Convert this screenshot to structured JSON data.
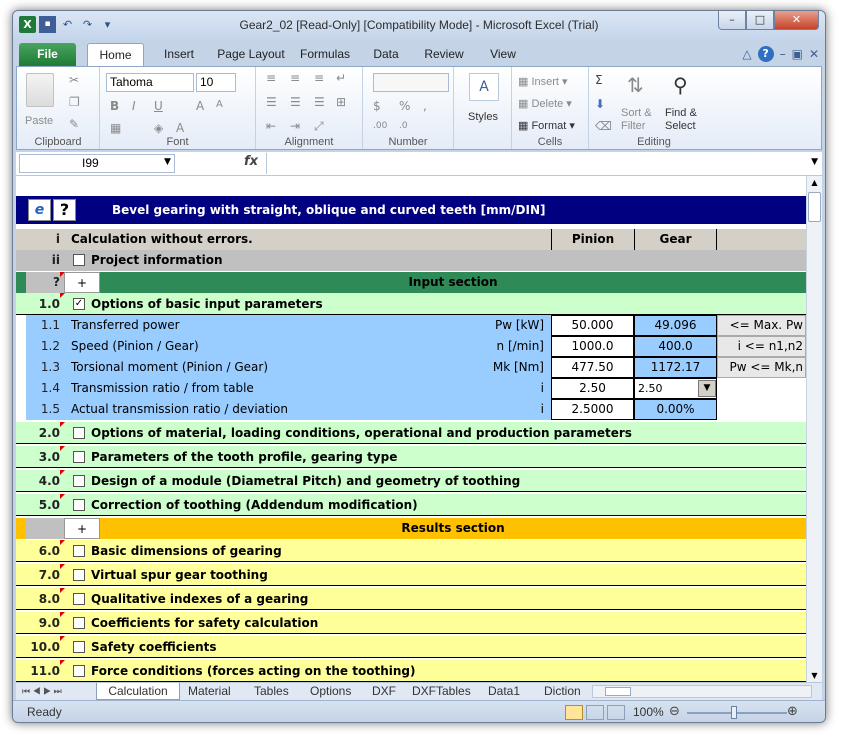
{
  "window": {
    "title": "Gear2_02  [Read-Only]  [Compatibility Mode]  -  Microsoft Excel (Trial)"
  },
  "ribbon": {
    "tabs": [
      "File",
      "Home",
      "Insert",
      "Page Layout",
      "Formulas",
      "Data",
      "Review",
      "View"
    ],
    "clipboard": {
      "label": "Clipboard",
      "paste": "Paste"
    },
    "font": {
      "label": "Font",
      "name": "Tahoma",
      "size": "10"
    },
    "alignment": {
      "label": "Alignment"
    },
    "number": {
      "label": "Number"
    },
    "styles": {
      "label": "Styles"
    },
    "cells": {
      "label": "Cells",
      "insert": "Insert",
      "delete": "Delete",
      "format": "Format"
    },
    "editing": {
      "label": "Editing",
      "sort": "Sort &",
      "filter": "Filter",
      "find": "Find &",
      "select": "Select"
    }
  },
  "formula_bar": {
    "name_box": "I99",
    "fx": "fx",
    "value": ""
  },
  "sheet": {
    "title": "Bevel gearing with straight, oblique and curved teeth [mm/DIN]",
    "header_row": {
      "num": "i",
      "text": "Calculation without errors.",
      "col1": "Pinion",
      "col2": "Gear"
    },
    "project_row": {
      "num": "ii",
      "text": "Project information"
    },
    "input_section": {
      "num": "?",
      "plus": "+",
      "label": "Input section"
    },
    "options_row": {
      "num": "1.0",
      "text": "Options of basic input parameters",
      "check": "✓"
    },
    "param_rows": [
      {
        "num": "1.1",
        "label": "Transferred power",
        "unit": "Pw [kW]",
        "v1": "50.000",
        "v2": "49.096",
        "note": "<= Max. Pw"
      },
      {
        "num": "1.2",
        "label": "Speed (Pinion / Gear)",
        "unit": "n [/min]",
        "v1": "1000.0",
        "v2": "400.0",
        "note": "i <= n1,n2"
      },
      {
        "num": "1.3",
        "label": "Torsional moment (Pinion / Gear)",
        "unit": "Mk [Nm]",
        "v1": "477.50",
        "v2": "1172.17",
        "note": "Pw <= Mk,n"
      },
      {
        "num": "1.4",
        "label": "Transmission ratio / from table",
        "unit": "i",
        "v1": "2.50",
        "v2": "2.50",
        "note": ""
      },
      {
        "num": "1.5",
        "label": "Actual transmission ratio / deviation",
        "unit": "i",
        "v1": "2.5000",
        "v2": "0.00%",
        "note": ""
      }
    ],
    "input_groups": [
      {
        "num": "2.0",
        "text": "Options of material, loading conditions, operational and production parameters"
      },
      {
        "num": "3.0",
        "text": "Parameters of the tooth profile, gearing type"
      },
      {
        "num": "4.0",
        "text": "Design of a module (Diametral Pitch) and geometry of toothing"
      },
      {
        "num": "5.0",
        "text": "Correction of toothing (Addendum modification)"
      }
    ],
    "results_section": {
      "plus": "+",
      "label": "Results section"
    },
    "result_groups": [
      {
        "num": "6.0",
        "text": "Basic dimensions of gearing"
      },
      {
        "num": "7.0",
        "text": "Virtual spur gear toothing"
      },
      {
        "num": "8.0",
        "text": "Qualitative indexes of a gearing"
      },
      {
        "num": "9.0",
        "text": "Coefficients for safety calculation"
      },
      {
        "num": "10.0",
        "text": "Safety coefficients"
      },
      {
        "num": "11.0",
        "text": "Force conditions (forces acting on the toothing)"
      }
    ]
  },
  "sheet_tabs": [
    "Calculation",
    "Material",
    "Tables",
    "Options",
    "DXF",
    "DXFTables",
    "Data1",
    "Diction"
  ],
  "status": {
    "ready": "Ready",
    "zoom": "100%"
  },
  "colors": {
    "title_bg": "#000080",
    "input_green": "#2e8b57",
    "results_orange": "#ffc000",
    "param_blue": "#99ccff",
    "group_green": "#ccffcc",
    "result_yellow": "#ffff99"
  }
}
